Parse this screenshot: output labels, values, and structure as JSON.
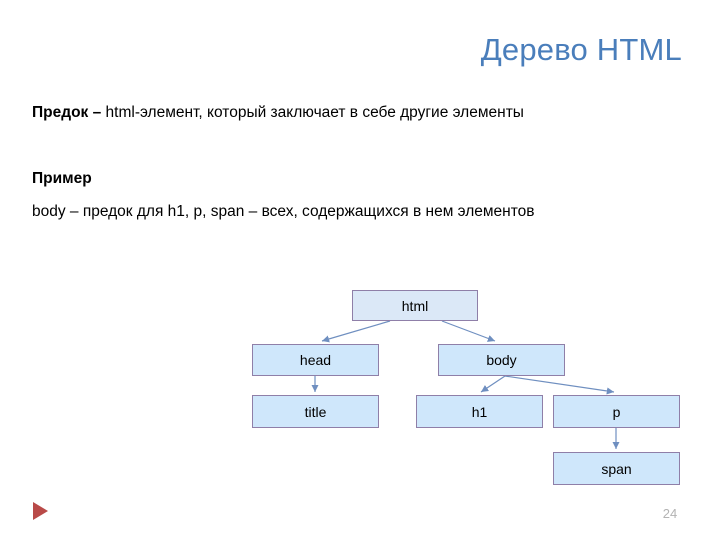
{
  "slide": {
    "title": "Дерево HTML",
    "page_number": "24",
    "title_color": "#4a7ebb",
    "play_marker_color": "#b94a48",
    "page_number_color": "#b3b3b3"
  },
  "content": {
    "definition": {
      "lead": "Предок",
      "dash": "–",
      "rest": " html-элемент, который заключает в себе другие элементы",
      "full": "Предок – html-элемент, который заключает в себе другие элементы"
    },
    "example_heading": "Пример",
    "example_text": "body – предок для h1, p, span – всех, содержащихся в нем элементов"
  },
  "diagram": {
    "node_fill": "#cfe7fb",
    "root_fill": "#dbe8f7",
    "node_border": "#8f7fa8",
    "connector_color": "#6f8fc0",
    "nodes": [
      {
        "id": "html",
        "label": "html"
      },
      {
        "id": "head",
        "label": "head"
      },
      {
        "id": "body",
        "label": "body"
      },
      {
        "id": "title",
        "label": "title"
      },
      {
        "id": "h1",
        "label": "h1"
      },
      {
        "id": "p",
        "label": "p"
      },
      {
        "id": "span",
        "label": "span"
      }
    ],
    "edges": [
      {
        "from": "html",
        "to": "head"
      },
      {
        "from": "html",
        "to": "body"
      },
      {
        "from": "head",
        "to": "title"
      },
      {
        "from": "body",
        "to": "h1"
      },
      {
        "from": "body",
        "to": "p"
      },
      {
        "from": "p",
        "to": "span"
      }
    ]
  }
}
